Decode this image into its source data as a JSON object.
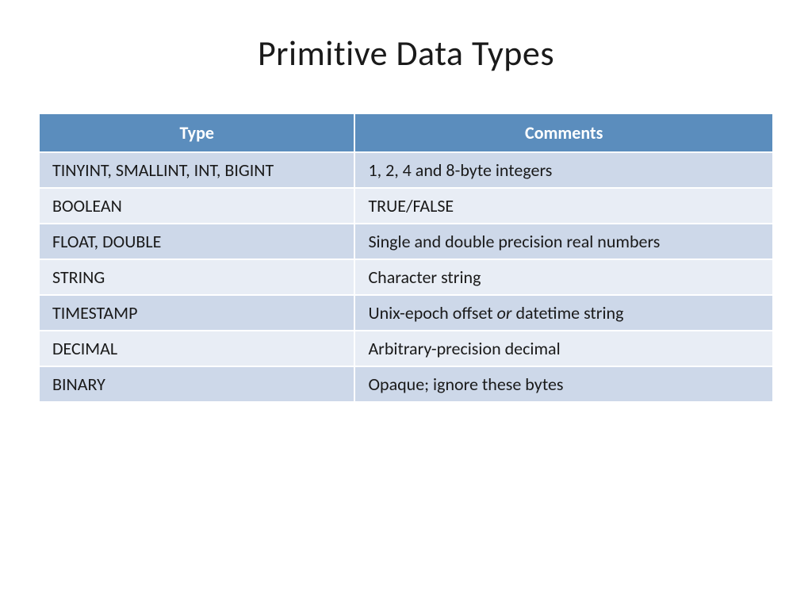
{
  "title": "Primitive Data Types",
  "headers": {
    "type": "Type",
    "comments": "Comments"
  },
  "rows": [
    {
      "type": "TINYINT, SMALLINT, INT, BIGINT",
      "comment_parts": [
        {
          "text": "1, 2, 4 and 8-byte integers",
          "italic": false
        }
      ]
    },
    {
      "type": "BOOLEAN",
      "comment_parts": [
        {
          "text": "TRUE/FALSE",
          "italic": false
        }
      ]
    },
    {
      "type": "FLOAT, DOUBLE",
      "comment_parts": [
        {
          "text": "Single and double precision real numbers",
          "italic": false
        }
      ]
    },
    {
      "type": "STRING",
      "comment_parts": [
        {
          "text": "Character string",
          "italic": false
        }
      ]
    },
    {
      "type": "TIMESTAMP",
      "comment_parts": [
        {
          "text": "Unix-epoch offset ",
          "italic": false
        },
        {
          "text": "or",
          "italic": true
        },
        {
          "text": " datetime string",
          "italic": false
        }
      ]
    },
    {
      "type": "DECIMAL",
      "comment_parts": [
        {
          "text": "Arbitrary-precision decimal",
          "italic": false
        }
      ]
    },
    {
      "type": "BINARY",
      "comment_parts": [
        {
          "text": "Opaque; ignore these bytes",
          "italic": false
        }
      ]
    }
  ]
}
